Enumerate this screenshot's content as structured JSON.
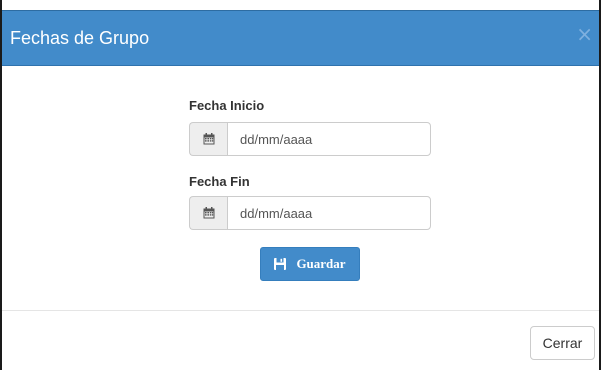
{
  "modal": {
    "title": "Fechas de Grupo",
    "close_symbol": "×"
  },
  "form": {
    "start_date": {
      "label": "Fecha Inicio",
      "placeholder": "dd/mm/aaaa",
      "icon": "calendar-icon"
    },
    "end_date": {
      "label": "Fecha Fin",
      "placeholder": "dd/mm/aaaa",
      "icon": "calendar-icon"
    },
    "save_button": {
      "label": "Guardar",
      "icon": "floppy-disk-icon"
    }
  },
  "footer": {
    "close_button_label": "Cerrar"
  },
  "colors": {
    "header_bg": "#428bca",
    "primary_button": "#428bca",
    "addon_bg": "#eeeeee",
    "border": "#cccccc"
  }
}
